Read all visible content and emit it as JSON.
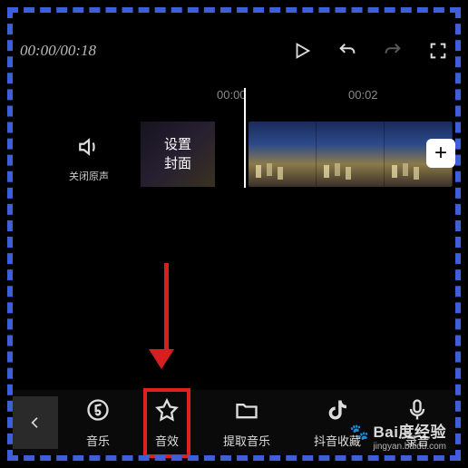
{
  "timecode": "00:00/00:18",
  "ruler": {
    "t1": "00:00",
    "t2": "00:02"
  },
  "sound_toggle_label": "关闭原声",
  "cover_label": "设置\n封面",
  "add_label": "+",
  "toolbar": {
    "music": "音乐",
    "effects": "音效",
    "extract": "提取音乐",
    "douyin": "抖音收藏",
    "record": "录音"
  },
  "watermark": {
    "main": "Bai度经验",
    "sub": "jingyan.baidu.com"
  }
}
